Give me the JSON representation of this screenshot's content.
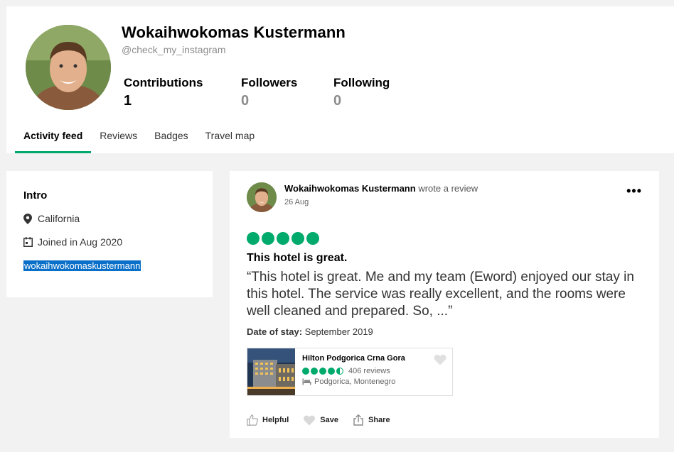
{
  "profile": {
    "name": "Wokaihwokomas Kustermann",
    "handle": "@check_my_instagram",
    "stats": [
      {
        "label": "Contributions",
        "value": "1"
      },
      {
        "label": "Followers",
        "value": "0"
      },
      {
        "label": "Following",
        "value": "0"
      }
    ],
    "tabs": [
      "Activity feed",
      "Reviews",
      "Badges",
      "Travel map"
    ],
    "active_tab": "Activity feed"
  },
  "intro": {
    "title": "Intro",
    "location": "California",
    "joined": "Joined in Aug 2020",
    "link": "wokaihwokomaskustermann"
  },
  "review": {
    "author": "Wokaihwokomas Kustermann",
    "action": "wrote a review",
    "date": "26 Aug",
    "more": "•••",
    "rating": 5,
    "title": "This hotel is great.",
    "body": "“This hotel is great. Me and my team (Eword) enjoyed our stay in this hotel. The service was really excellent, and the rooms were well cleaned and prepared. So, ...”",
    "stay_label": "Date of stay:",
    "stay_value": "September 2019",
    "hotel": {
      "name": "Hilton Podgorica Crna Gora",
      "rating": 4.5,
      "reviews": "406 reviews",
      "location": "Podgorica, Montenegro"
    },
    "actions": {
      "helpful": "Helpful",
      "save": "Save",
      "share": "Share"
    }
  },
  "colors": {
    "accent": "#00aa6c",
    "selection": "#0a6fc8"
  }
}
